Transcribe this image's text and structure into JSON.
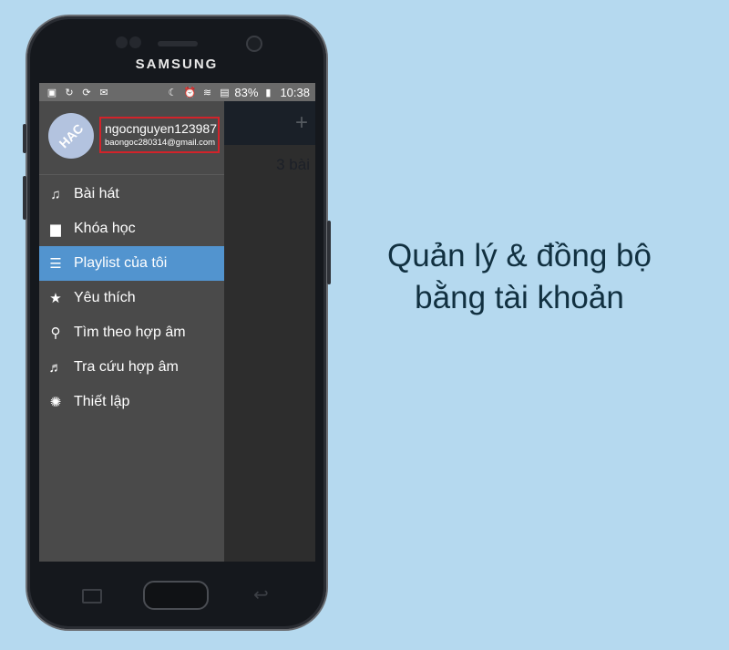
{
  "device": {
    "brand": "SAMSUNG"
  },
  "statusbar": {
    "left_icons": [
      "gallery-icon",
      "sync-icon",
      "refresh-icon",
      "gmail-icon"
    ],
    "right_icons": [
      "night-mode-icon",
      "alarm-icon",
      "wifi-icon",
      "sd-card-icon"
    ],
    "battery": "83%",
    "time": "10:38"
  },
  "background_app": {
    "add_symbol": "+",
    "count_text": "3 bài"
  },
  "drawer": {
    "avatar_text": "HAC",
    "username": "ngocnguyen123987",
    "email": "baongoc280314@gmail.com",
    "items": [
      {
        "label": "Bài hát",
        "icon": "music-note-icon",
        "glyph": "♫",
        "active": false
      },
      {
        "label": "Khóa học",
        "icon": "course-icon",
        "glyph": "▆",
        "active": false
      },
      {
        "label": "Playlist của tôi",
        "icon": "list-icon",
        "glyph": "☰",
        "active": true
      },
      {
        "label": "Yêu thích",
        "icon": "star-icon",
        "glyph": "★",
        "active": false
      },
      {
        "label": "Tìm theo hợp âm",
        "icon": "search-icon",
        "glyph": "⚲",
        "active": false
      },
      {
        "label": "Tra cứu hợp âm",
        "icon": "chord-lookup-icon",
        "glyph": "♬",
        "active": false
      },
      {
        "label": "Thiết lập",
        "icon": "gear-icon",
        "glyph": "✺",
        "active": false
      }
    ]
  },
  "caption": {
    "line1": "Quản lý & đồng bộ",
    "line2": "bằng tài khoản"
  },
  "colors": {
    "accent": "#5294cf",
    "highlight_border": "#d2232a",
    "page_bg": "#b5d9ef"
  }
}
